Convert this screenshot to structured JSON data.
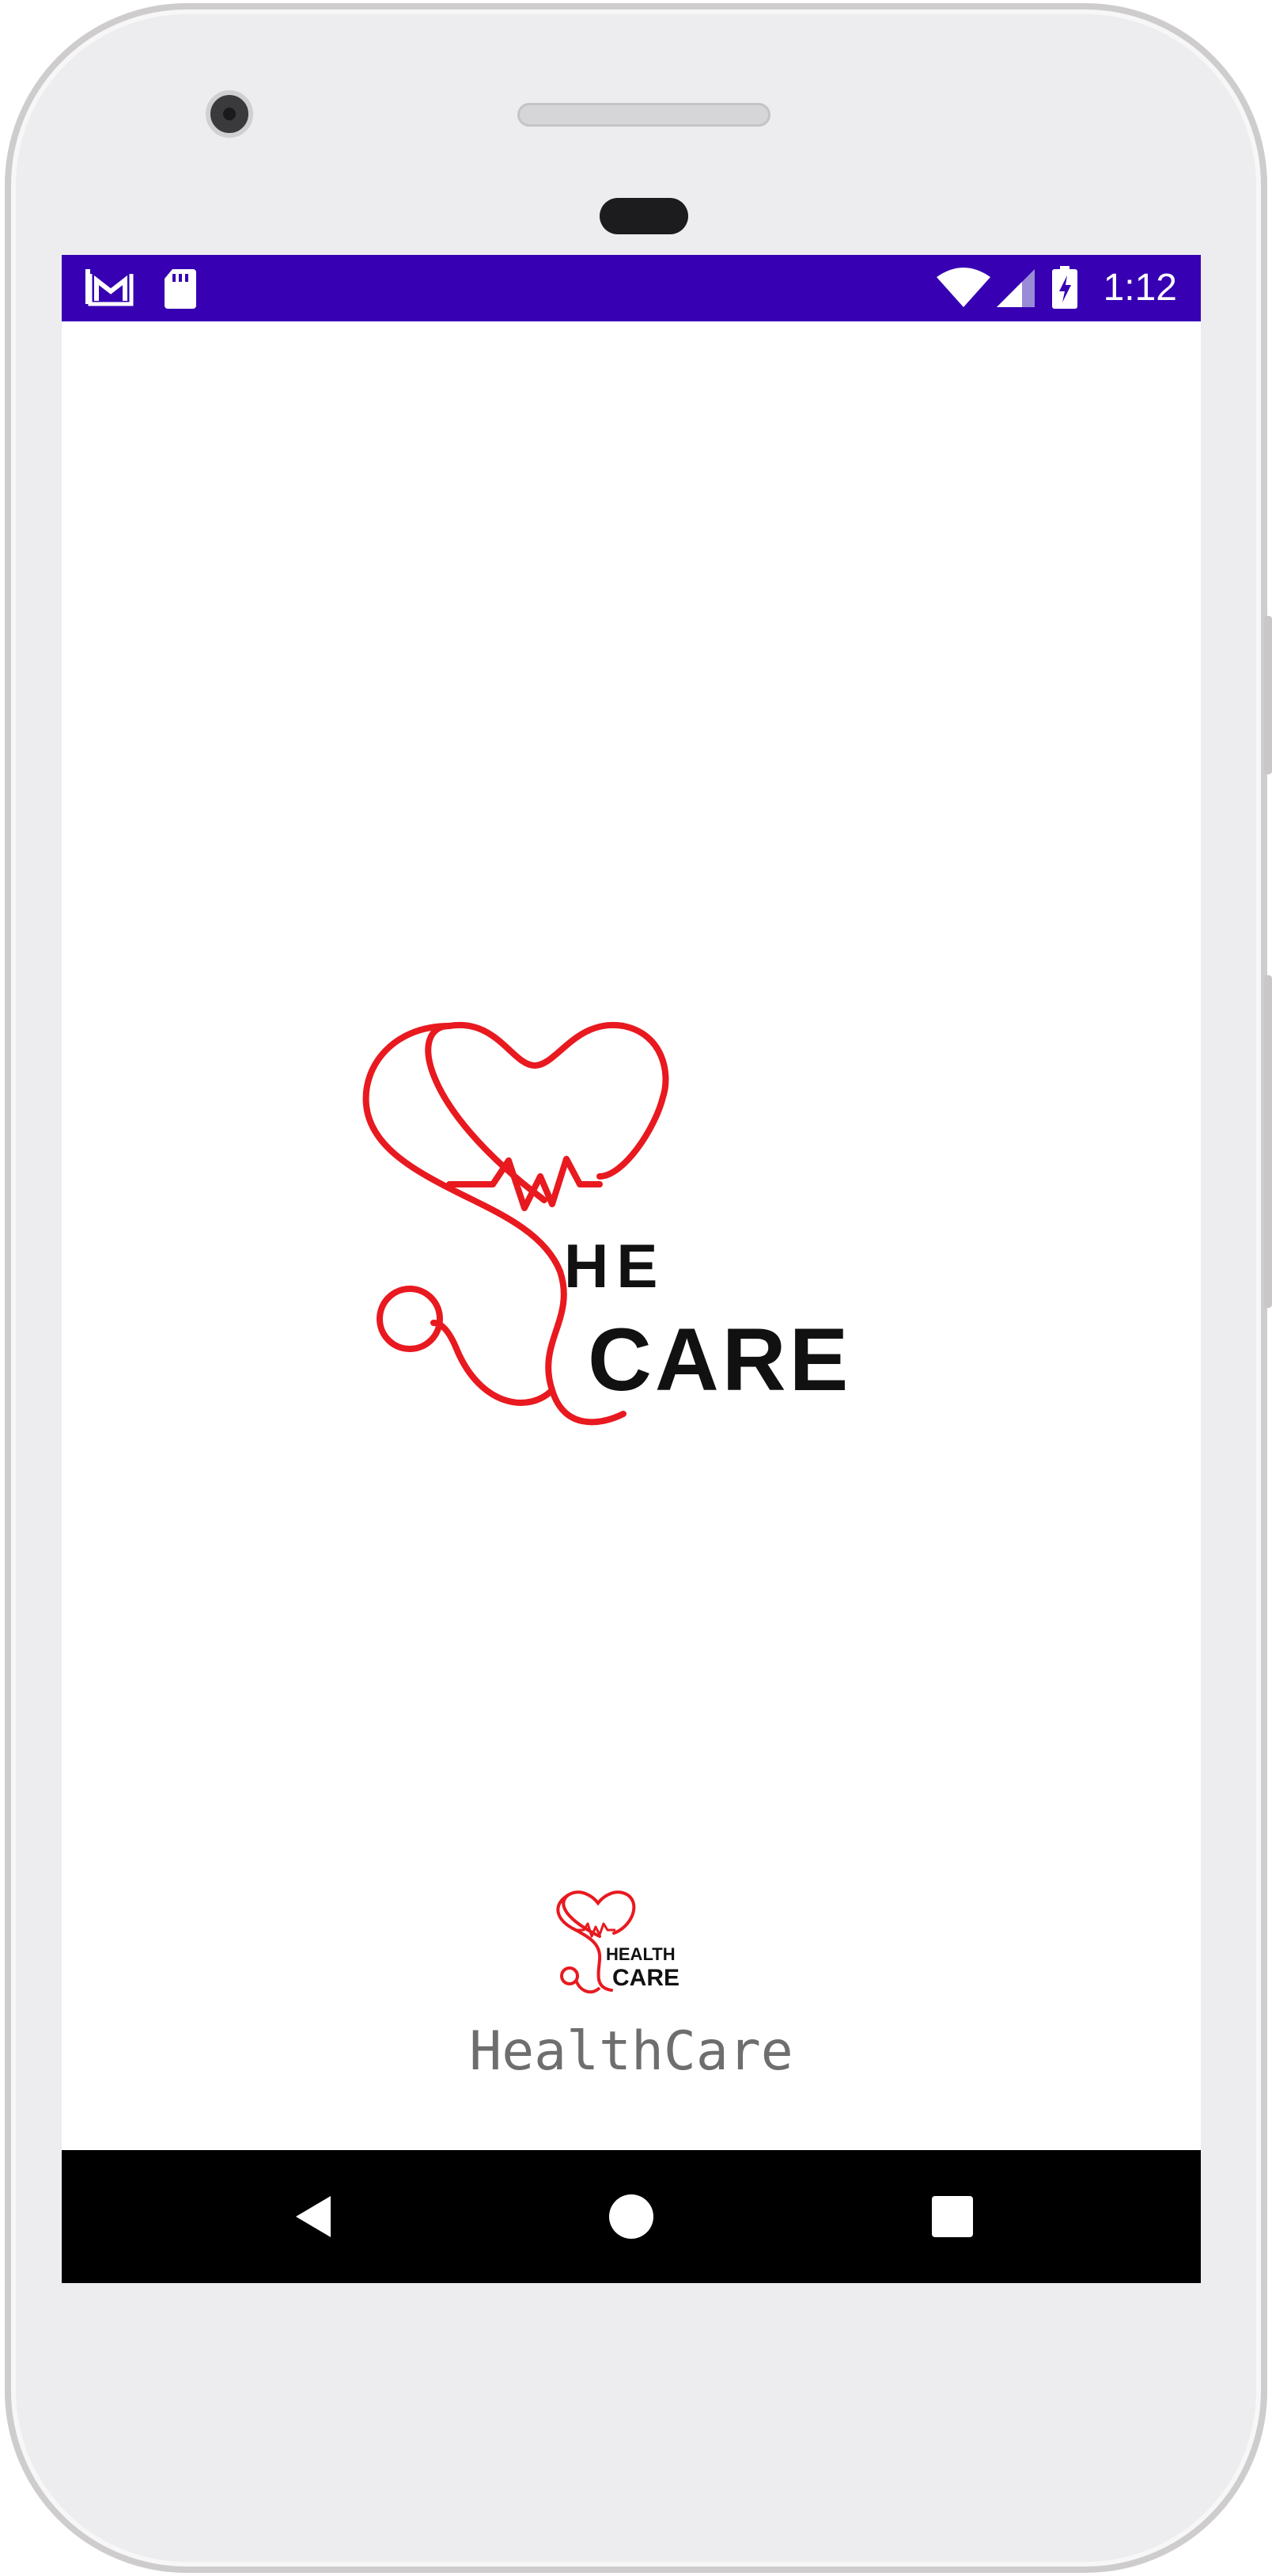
{
  "status_bar": {
    "time": "1:12",
    "icons": [
      "gmail-icon",
      "sd-card-icon",
      "wifi-icon",
      "cell-signal-icon",
      "battery-charging-icon"
    ],
    "background": "#3700b3"
  },
  "splash": {
    "logo_large": {
      "line1": "HE",
      "line2": "CARE"
    },
    "logo_small": {
      "line1": "HEALTH",
      "line2": "CARE"
    },
    "app_name": "HealthCare",
    "accent_color": "#e8191f"
  },
  "nav_bar": {
    "buttons": [
      "back-icon",
      "home-icon",
      "recents-icon"
    ]
  }
}
